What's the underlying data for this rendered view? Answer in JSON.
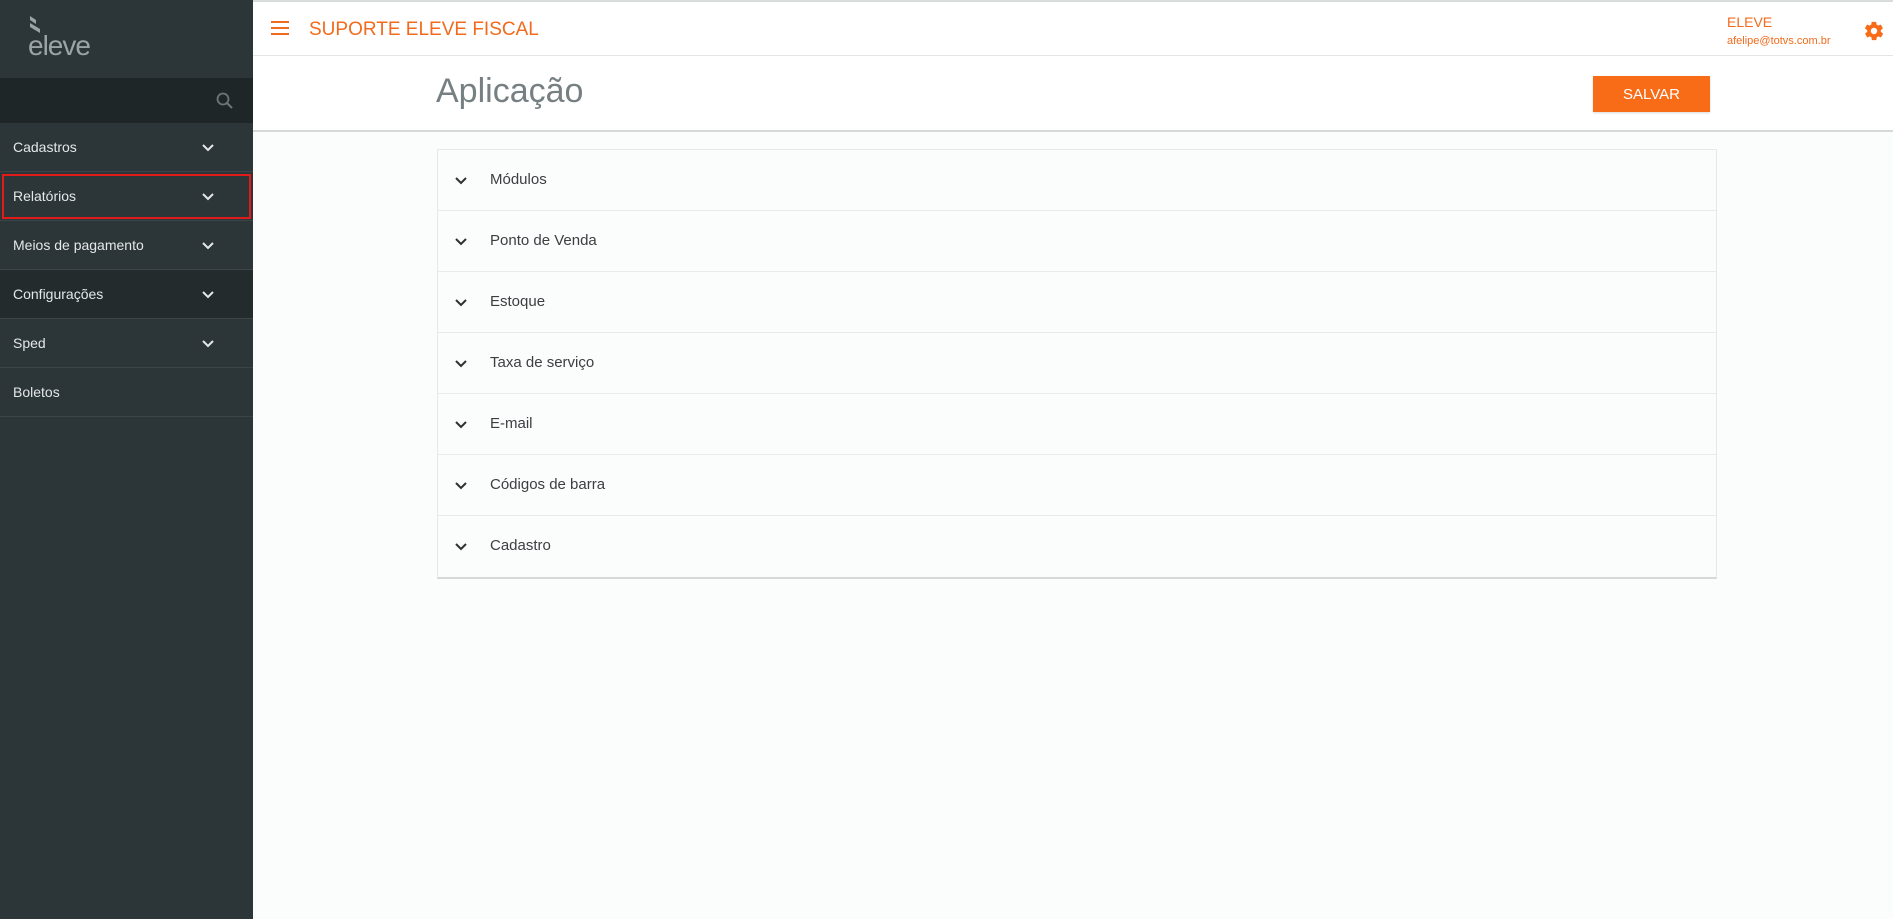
{
  "sidebar": {
    "logo_text": "eleve",
    "items": [
      {
        "label": "Cadastros",
        "has_chevron": true
      },
      {
        "label": "Relatórios",
        "has_chevron": true
      },
      {
        "label": "Meios de pagamento",
        "has_chevron": true
      },
      {
        "label": "Configurações",
        "has_chevron": true
      },
      {
        "label": "Sped",
        "has_chevron": true
      },
      {
        "label": "Boletos",
        "has_chevron": false
      }
    ]
  },
  "header": {
    "title": "SUPORTE ELEVE FISCAL",
    "user_name": "ELEVE",
    "user_email": "afelipe@totvs.com.br",
    "menu_icon": "hamburger-icon",
    "settings_icon": "gear-icon"
  },
  "page": {
    "title": "Aplicação",
    "save_label": "SALVAR"
  },
  "accordion": {
    "items": [
      "Módulos",
      "Ponto de Venda",
      "Estoque",
      "Taxa de serviço",
      "E-mail",
      "Códigos de barra",
      "Cadastro"
    ]
  },
  "colors": {
    "accent": "#f26b1d",
    "button": "#f86b17",
    "sidebar_bg": "#2c3538",
    "highlight_box": "#e11a1a"
  }
}
